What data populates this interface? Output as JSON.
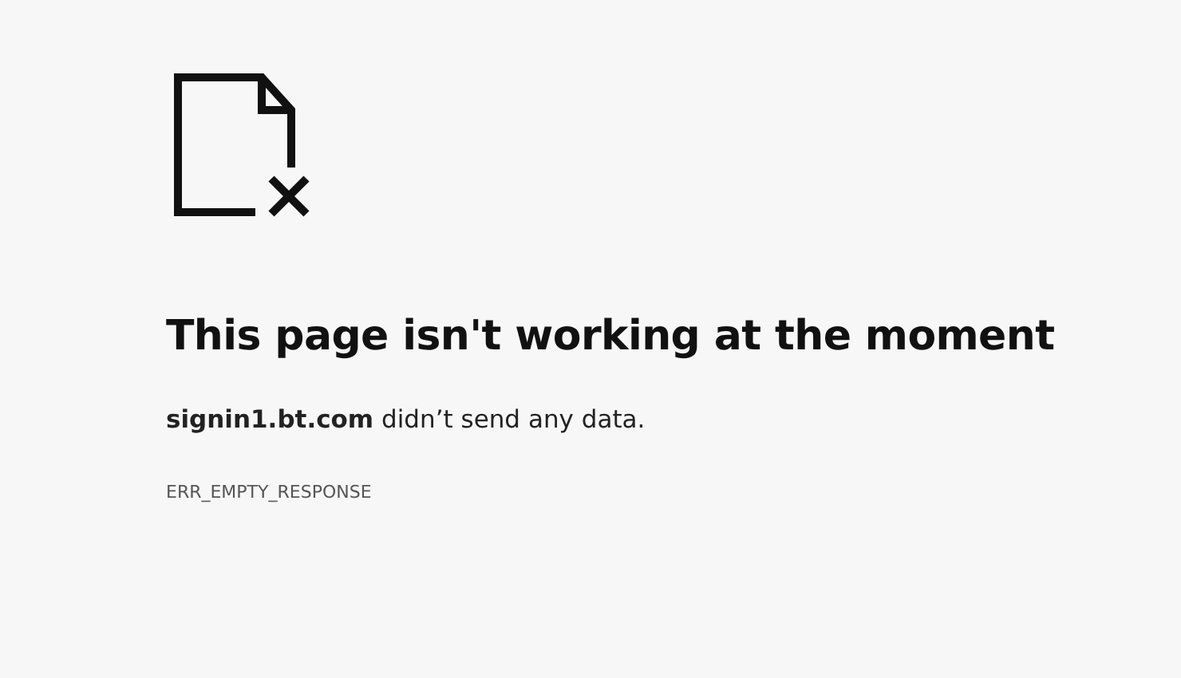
{
  "heading": "This page isn't working at the moment",
  "message": "**signin1.bt.com** didn’t send any data.",
  "error_code": "ERR_EMPTY_RESPONSE"
}
